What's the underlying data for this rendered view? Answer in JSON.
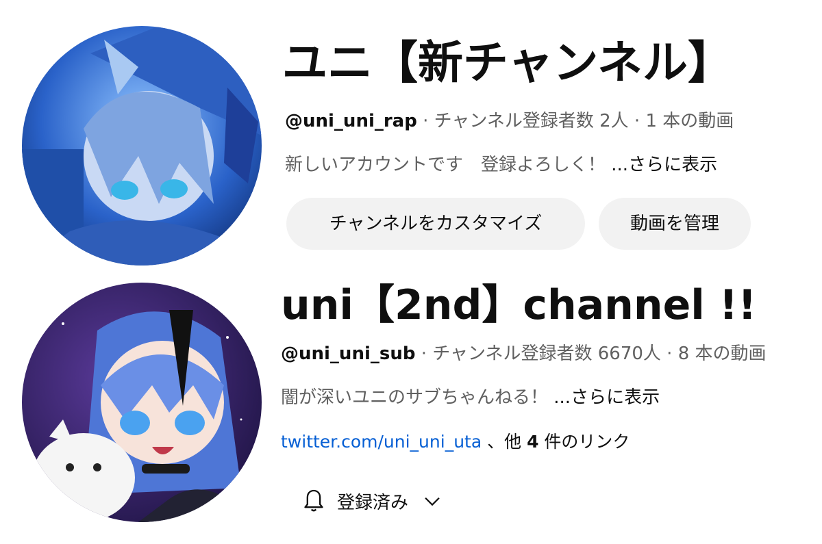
{
  "channels": [
    {
      "name": "ユニ【新チャンネル】",
      "handle": "@uni_uni_rap",
      "stats": " · チャンネル登録者数 2人 · 1 本の動画",
      "description": "新しいアカウントです　登録よろしく！",
      "more": " ...さらに表示",
      "buttons": [
        "チャンネルをカスタマイズ",
        "動画を管理"
      ]
    },
    {
      "name": "uni【2nd】channel !!",
      "handle": "@uni_uni_sub",
      "stats": " · チャンネル登録者数 6670人 · 8 本の動画",
      "description": "闇が深いユニのサブちゃんねる！",
      "more": " ...さらに表示",
      "link": "twitter.com/uni_uni_uta",
      "links_sep": " 、他 ",
      "links_count": "4",
      "links_suffix": " 件のリンク",
      "subscribe_label": "登録済み"
    }
  ],
  "icons": {
    "bell": "notification-bell-icon",
    "chevron": "chevron-down-icon"
  },
  "colors": {
    "link": "#065fd4",
    "secondary_text": "#606060",
    "button_bg": "#f2f2f2"
  }
}
